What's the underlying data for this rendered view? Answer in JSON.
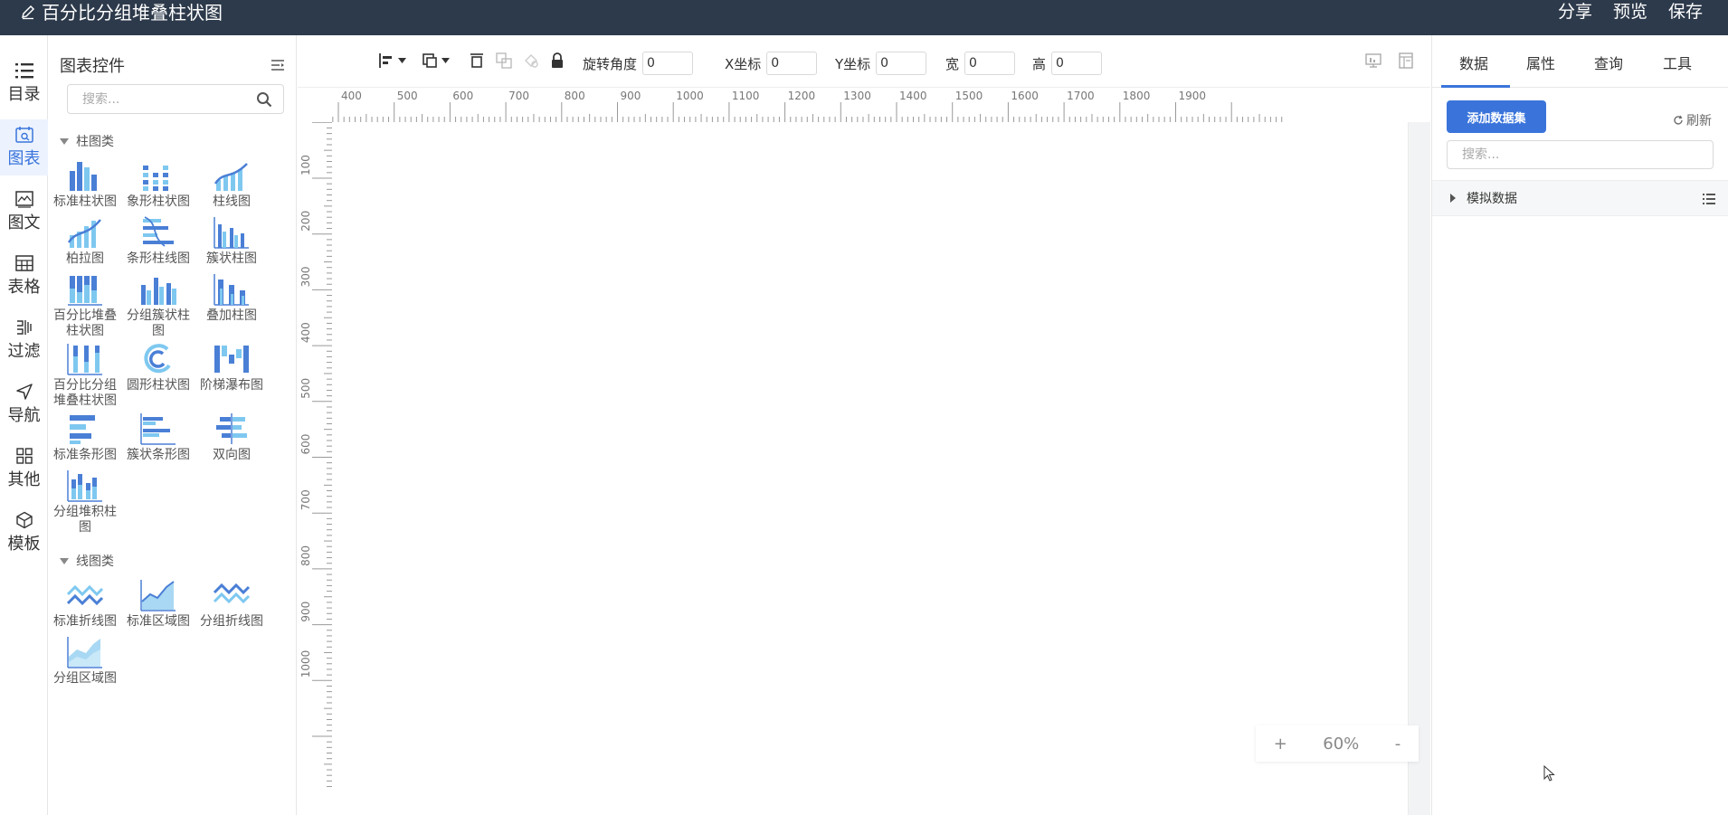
{
  "header": {
    "title": "百分比分组堆叠柱状图",
    "actions": [
      "分享",
      "预览",
      "保存"
    ]
  },
  "left_nav": [
    {
      "label": "目录",
      "icon": "list-icon",
      "active": false
    },
    {
      "label": "图表",
      "icon": "chart-icon",
      "active": true
    },
    {
      "label": "图文",
      "icon": "image-text-icon",
      "active": false
    },
    {
      "label": "表格",
      "icon": "table-icon",
      "active": false
    },
    {
      "label": "过滤",
      "icon": "filter-icon",
      "active": false
    },
    {
      "label": "导航",
      "icon": "navigation-icon",
      "active": false
    },
    {
      "label": "其他",
      "icon": "grid-icon",
      "active": false
    },
    {
      "label": "模板",
      "icon": "template-icon",
      "active": false
    }
  ],
  "widget_panel": {
    "title": "图表控件",
    "search_placeholder": "搜索...",
    "categories": [
      {
        "name": "柱图类",
        "items": [
          "标准柱状图",
          "象形柱状图",
          "柱线图",
          "柏拉图",
          "条形柱线图",
          "簇状柱图",
          "百分比堆叠柱状图",
          "分组簇状柱图",
          "叠加柱图",
          "百分比分组堆叠柱状图",
          "圆形柱状图",
          "阶梯瀑布图",
          "标准条形图",
          "簇状条形图",
          "双向图",
          "分组堆积柱图"
        ]
      },
      {
        "name": "线图类",
        "items": [
          "标准折线图",
          "标准区域图",
          "分组折线图",
          "分组区域图"
        ]
      }
    ]
  },
  "toolbar": {
    "fields": [
      {
        "label": "旋转角度",
        "value": "0"
      },
      {
        "label": "X坐标",
        "value": "0"
      },
      {
        "label": "Y坐标",
        "value": "0"
      },
      {
        "label": "宽",
        "value": "0"
      },
      {
        "label": "高",
        "value": "0"
      }
    ]
  },
  "ruler": {
    "top_labels": [
      "400",
      "500",
      "600",
      "700",
      "800",
      "900",
      "1000",
      "1100",
      "1200",
      "1300",
      "1400",
      "1500",
      "1600",
      "1700",
      "1800",
      "1900"
    ],
    "left_labels": [
      "100",
      "200",
      "300",
      "400",
      "500",
      "600",
      "700",
      "800",
      "900",
      "1000"
    ]
  },
  "zoom": {
    "plus": "+",
    "level": "60%",
    "minus": "-"
  },
  "right_panel": {
    "tabs": [
      "数据",
      "属性",
      "查询",
      "工具"
    ],
    "active_tab": "数据",
    "add_button": "添加数据集",
    "refresh": "刷新",
    "search_placeholder": "搜索...",
    "dataset": "模拟数据"
  },
  "colors": {
    "header_bg": "#2d3a4b",
    "accent": "#3a74db",
    "icon_dark": "#4a7fd6",
    "icon_light": "#7ec8f0"
  }
}
